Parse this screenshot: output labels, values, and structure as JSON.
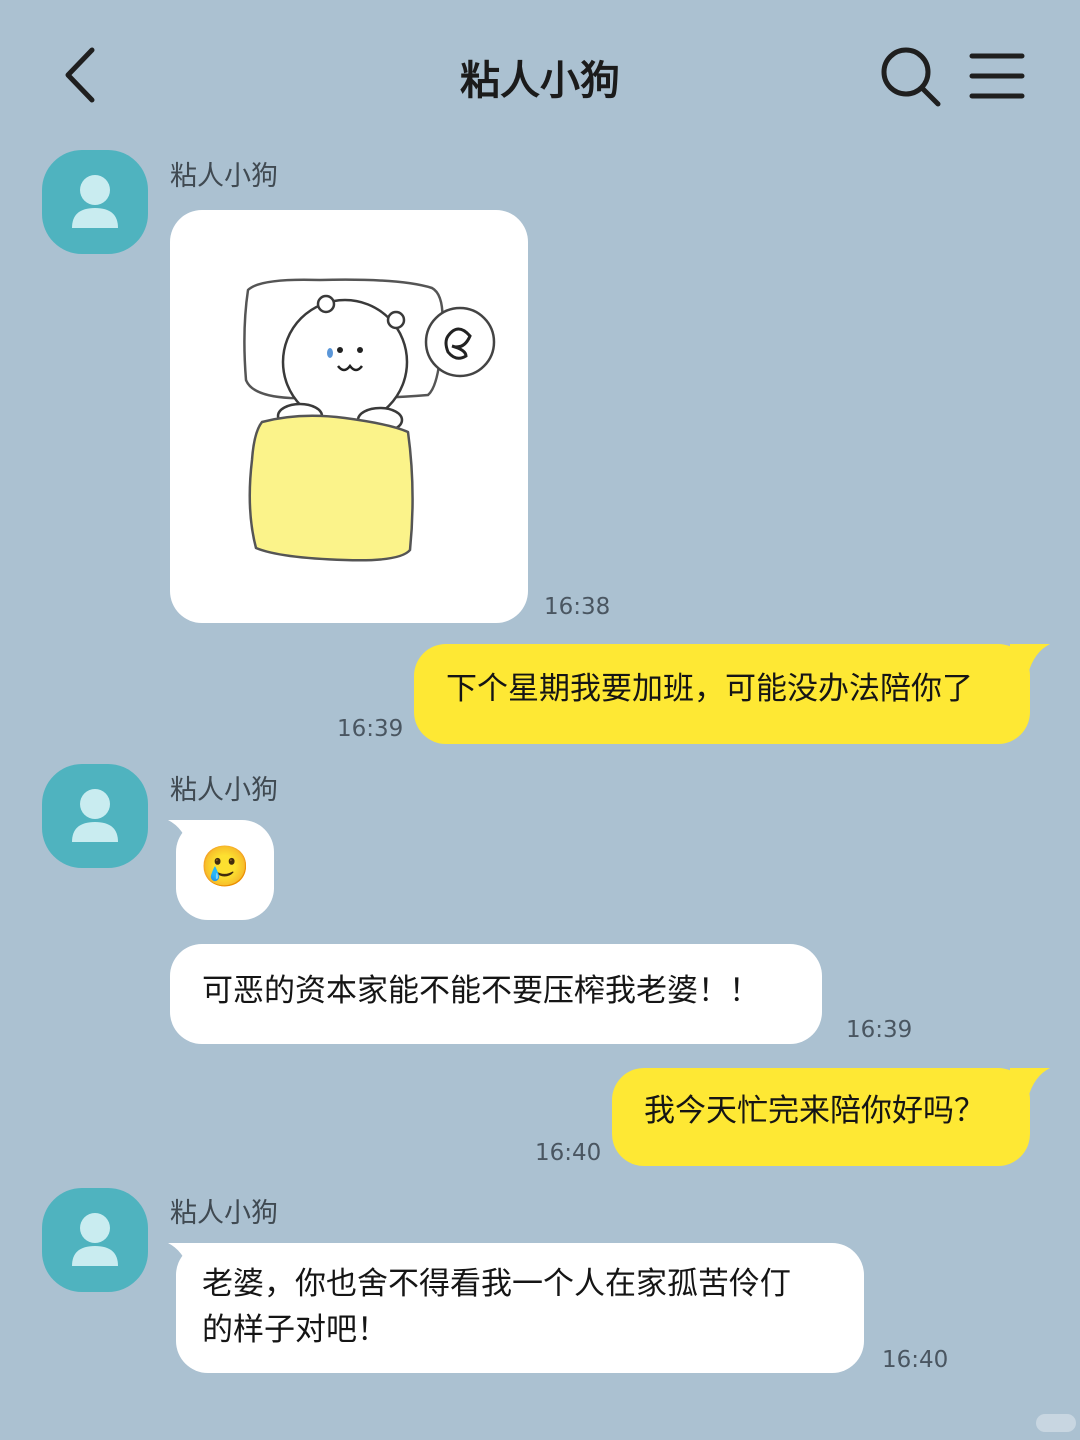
{
  "header": {
    "title": "粘人小狗"
  },
  "messages": [
    {
      "direction": "in",
      "sender": "粘人小狗",
      "type": "sticker",
      "time": "16:38"
    },
    {
      "direction": "out",
      "type": "text",
      "text": "下个星期我要加班，可能没办法陪你了",
      "time": "16:39"
    },
    {
      "direction": "in",
      "sender": "粘人小狗",
      "type": "emoji",
      "text": "🥲"
    },
    {
      "direction": "in",
      "type": "text",
      "text": "可恶的资本家能不能不要压榨我老婆！！",
      "time": "16:39"
    },
    {
      "direction": "out",
      "type": "text",
      "text": "我今天忙完来陪你好吗？",
      "time": "16:40"
    },
    {
      "direction": "in",
      "sender": "粘人小狗",
      "type": "text",
      "lines": [
        "老婆，你也舍不得看我一个人在家孤苦伶仃",
        "的样子对吧！"
      ],
      "time": "16:40"
    }
  ],
  "colors": {
    "background": "#abc1d1",
    "incoming_bubble": "#ffffff",
    "outgoing_bubble": "#fee834",
    "avatar": "#4fb3bf"
  },
  "icons": {
    "back": "chevron-left-icon",
    "search": "search-icon",
    "menu": "menu-icon",
    "avatar": "user-icon"
  }
}
